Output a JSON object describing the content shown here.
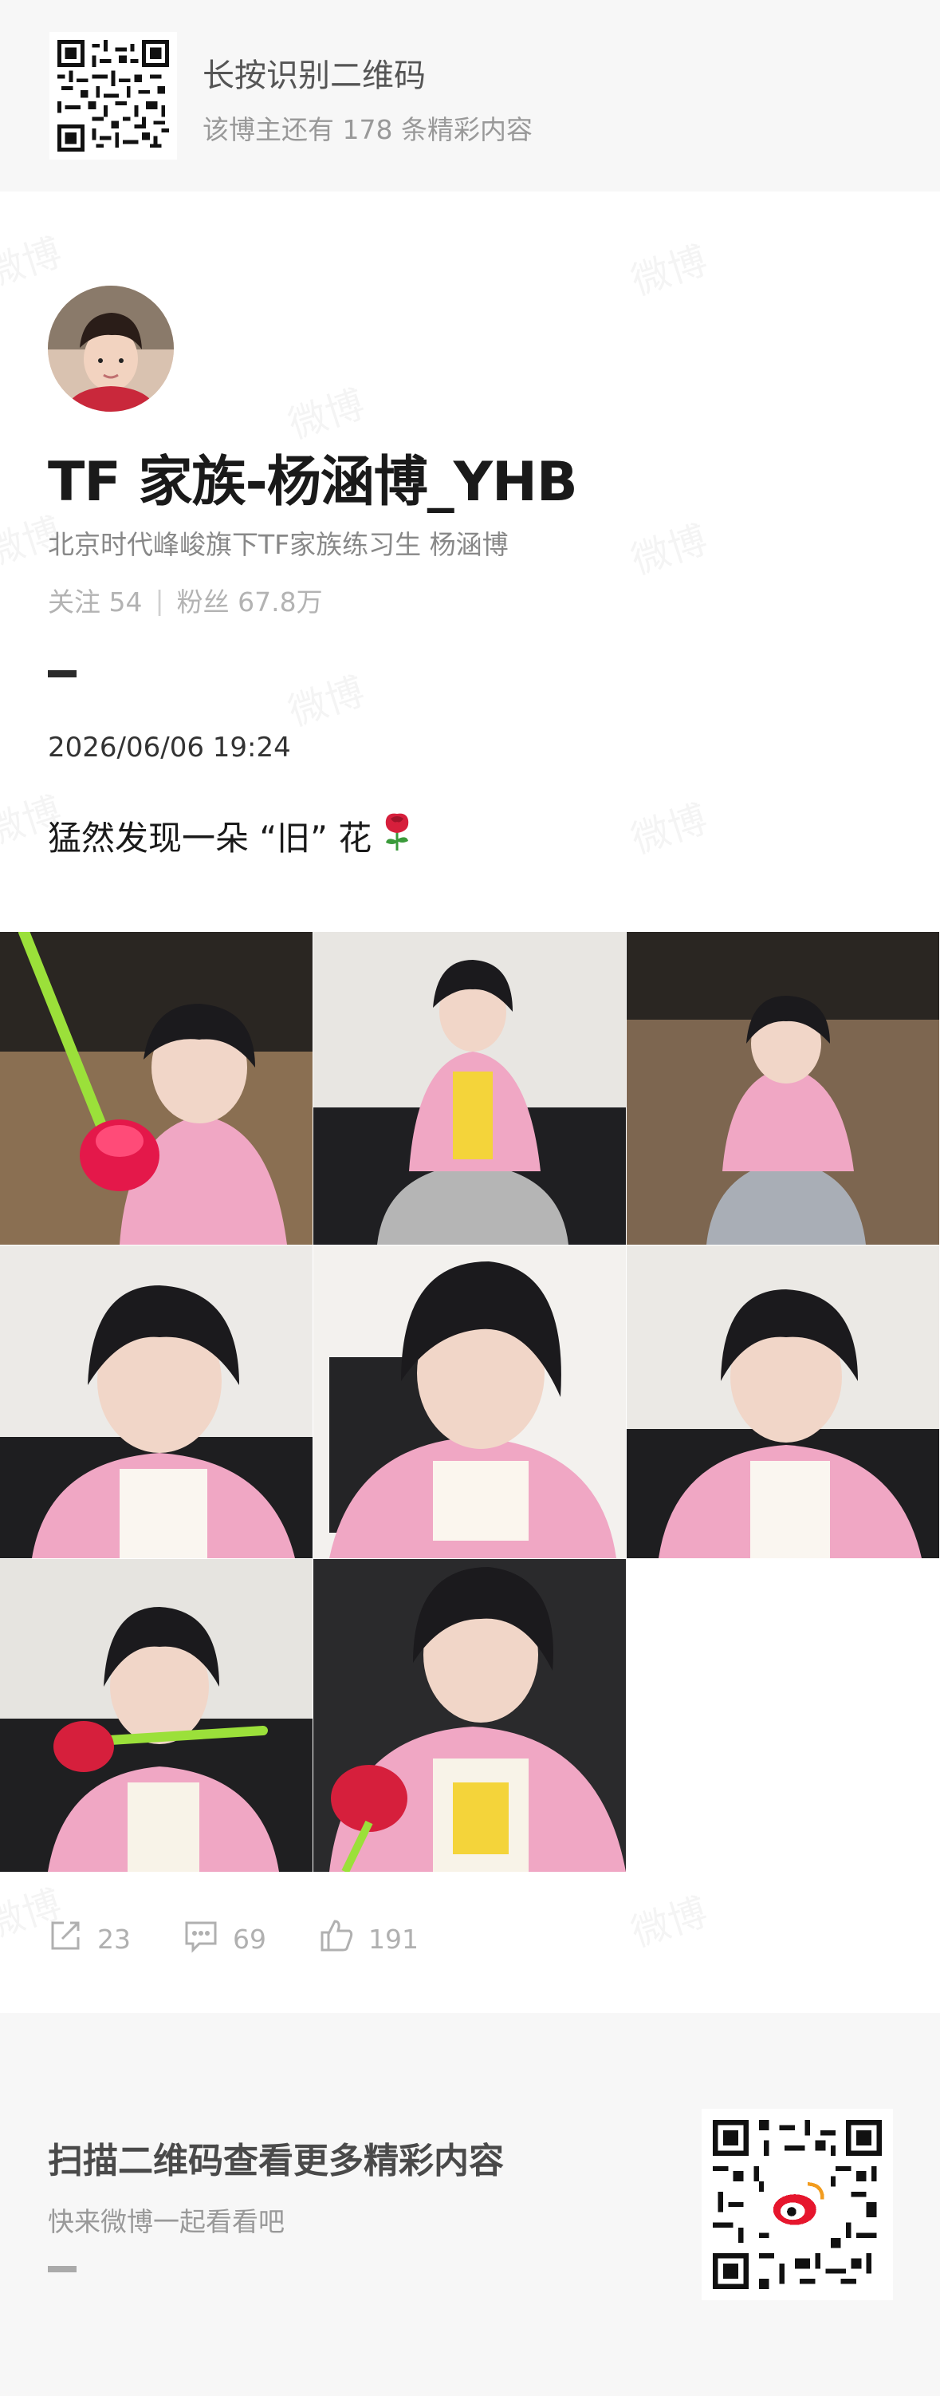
{
  "top_banner": {
    "title": "长按识别二维码",
    "subtitle": "该博主还有 178 条精彩内容"
  },
  "profile": {
    "name": "TF 家族-杨涵博_YHB",
    "bio": "北京时代峰峻旗下TF家族练习生 杨涵博",
    "following": "关注 54",
    "followers": "粉丝 67.8万",
    "separator": "|"
  },
  "post": {
    "timestamp": "2026/06/06 19:24",
    "text": "猛然发现一朵 “旧” 花",
    "emoji_icon": "rose-icon",
    "image_count": 8
  },
  "actions": {
    "repost": "23",
    "comment": "69",
    "like": "191"
  },
  "bottom_banner": {
    "title": "扫描二维码查看更多精彩内容",
    "subtitle": "快来微博一起看看吧"
  },
  "watermark": "微博",
  "colors": {
    "banner_bg": "#f7f7f7",
    "pink_shirt": "#f0a7c4",
    "rose_red": "#d61f3c",
    "stem_green": "#9be03a"
  }
}
